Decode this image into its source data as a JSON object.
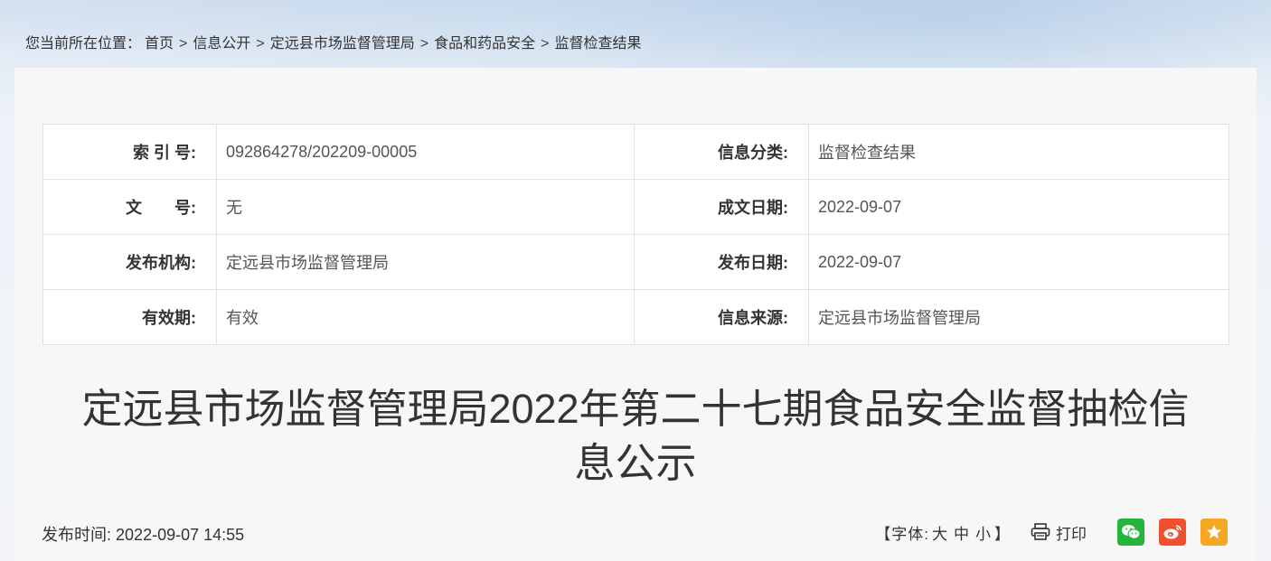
{
  "breadcrumb": {
    "prefix": "您当前所在位置：",
    "items": [
      "首页",
      "信息公开",
      "定远县市场监督管理局",
      "食品和药品安全",
      "监督检查结果"
    ],
    "separator": ">"
  },
  "meta": {
    "rows": [
      {
        "l1": "索 引 号:",
        "v1": "092864278/202209-00005",
        "l2": "信息分类:",
        "v2": "监督检查结果"
      },
      {
        "l1": "文　　号:",
        "v1": "无",
        "l2": "成文日期:",
        "v2": "2022-09-07"
      },
      {
        "l1": "发布机构:",
        "v1": "定远县市场监督管理局",
        "l2": "发布日期:",
        "v2": "2022-09-07"
      },
      {
        "l1": "有效期:",
        "v1": "有效",
        "l2": "信息来源:",
        "v2": "定远县市场监督管理局"
      }
    ]
  },
  "article": {
    "title_line1": "定远县市场监督管理局2022年第二十七期食品安全监督抽检信",
    "title_line2": "息公示",
    "pub_label": "发布时间:",
    "pub_time": "2022-09-07 14:55"
  },
  "tools": {
    "font_open": "【字体:",
    "font_large": "大",
    "font_medium": "中",
    "font_small": "小",
    "font_close": "】",
    "print_label": "打印",
    "share_icons": [
      "wechat-icon",
      "weibo-icon",
      "favorite-icon"
    ]
  },
  "colors": {
    "wechat": "#24b53c",
    "weibo": "#f0502d",
    "favorite": "#f5a623"
  }
}
